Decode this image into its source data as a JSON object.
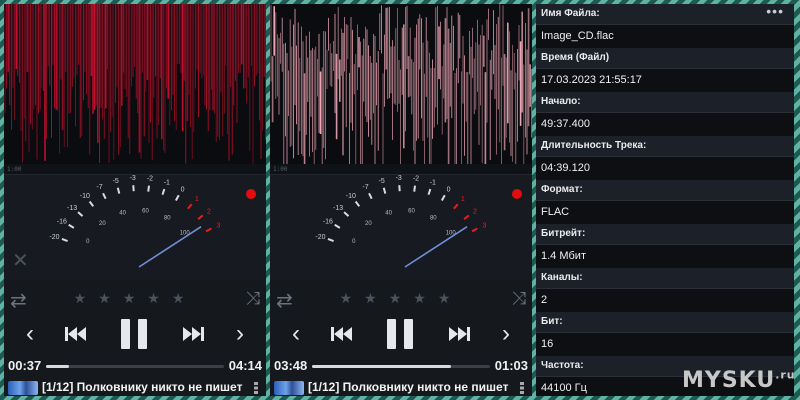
{
  "accent": "#d81b3a",
  "players": [
    {
      "scale_label": "1:00",
      "elapsed": "00:37",
      "remaining": "04:14",
      "progress": 0.13,
      "track_title": "[1/12] Полковнику никто не пишет",
      "waveform_color": "#c8102e"
    },
    {
      "scale_label": "1:00",
      "elapsed": "03:48",
      "remaining": "01:03",
      "progress": 0.78,
      "track_title": "[1/12] Полковнику никто не пишет",
      "waveform_color": "#f2a8b6"
    }
  ],
  "vu_scale": {
    "db_labels": [
      "-20",
      "-16",
      "-13",
      "-10",
      "-7",
      "-5",
      "-3",
      "-2",
      "-1",
      "0",
      "1",
      "2",
      "3"
    ],
    "pct_labels": [
      "0",
      "20",
      "40",
      "60",
      "80",
      "100"
    ]
  },
  "icons": {
    "repeat": "repeat-icon",
    "shuffle": "shuffle-icon",
    "rating": "star-icon",
    "back": "chevron-left-icon",
    "prev": "skip-previous-icon",
    "pause": "pause-icon",
    "next": "skip-next-icon",
    "forward": "chevron-right-icon",
    "close": "close-icon",
    "record": "record-indicator-icon",
    "more": "more-icon"
  },
  "info": {
    "fields": [
      {
        "label": "Имя Файла:",
        "value": "Image_CD.flac"
      },
      {
        "label": "Время (Файл)",
        "value": "17.03.2023 21:55:17"
      },
      {
        "label": "Начало:",
        "value": "49:37.400"
      },
      {
        "label": "Длительность Трека:",
        "value": "04:39.120"
      },
      {
        "label": "Формат:",
        "value": "FLAC"
      },
      {
        "label": "Битрейт:",
        "value": "1.4 Мбит"
      },
      {
        "label": "Каналы:",
        "value": "2"
      },
      {
        "label": "Бит:",
        "value": "16"
      },
      {
        "label": "Частота:",
        "value": "44100 Гц"
      }
    ]
  },
  "watermark": {
    "text": "MYSKU",
    "suffix": ".ru"
  }
}
